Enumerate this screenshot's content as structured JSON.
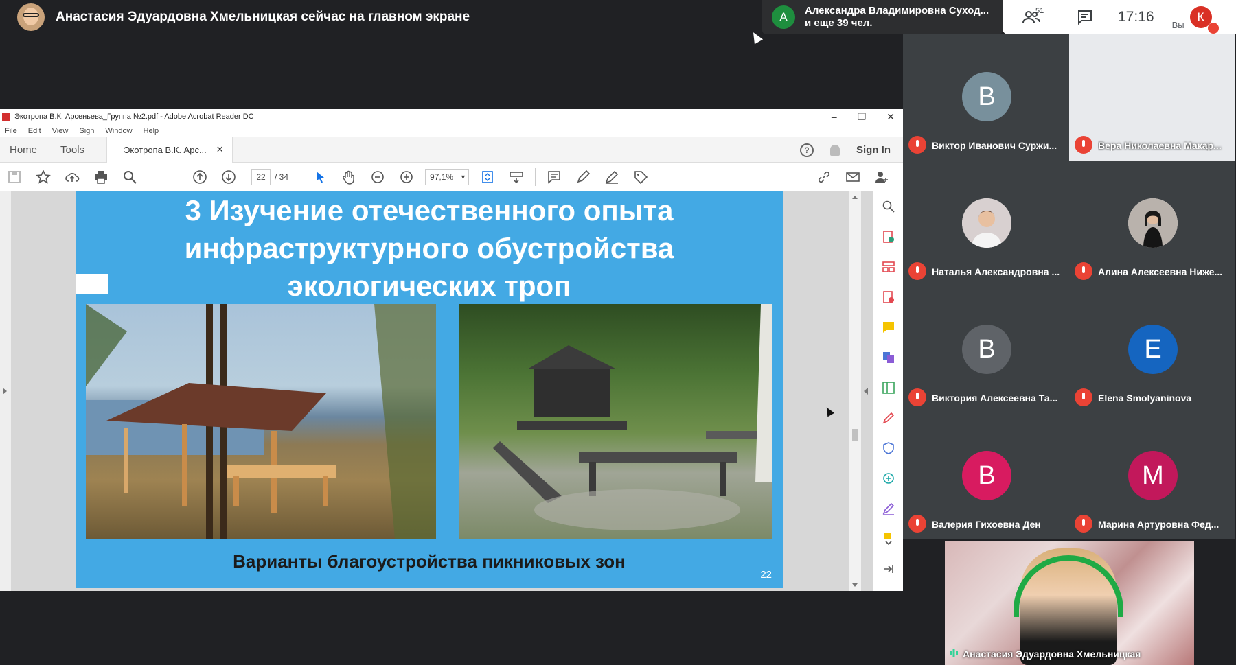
{
  "presenter": {
    "title": "Анастасия Эдуардовна Хмельницкая сейчас на главном экране"
  },
  "joiners": {
    "initial": "А",
    "line1": "Александра Владимировна Суход...",
    "line2": "и еще 39 чел."
  },
  "controls": {
    "people_count": "51",
    "time": "17:16",
    "you_label": "Вы",
    "self_initial": "К"
  },
  "acrobat": {
    "window_title": "Экотропа В.К. Арсеньева_Группа №2.pdf - Adobe Acrobat Reader DC",
    "menu": [
      "File",
      "Edit",
      "View",
      "Sign",
      "Window",
      "Help"
    ],
    "tabs": {
      "home": "Home",
      "tools": "Tools",
      "doc": "Экотропа В.К. Арс...",
      "sign_in": "Sign In"
    },
    "page_current": "22",
    "page_total": "/ 34",
    "zoom": "97,1%"
  },
  "slide": {
    "title_lines": [
      "3 Изучение отечественного опыта",
      "инфраструктурного обустройства",
      "экологических троп"
    ],
    "caption": "Варианты благоустройства пикниковых зон",
    "page_number": "22"
  },
  "participants": [
    {
      "name": "Виктор Иванович Суржи...",
      "initial": "В",
      "color": "#78909c"
    },
    {
      "name": "Вера Николаевна Макар...",
      "initial": "",
      "color": "#ffffff"
    },
    {
      "name": "Наталья Александровна ...",
      "initial": "",
      "color": "#e0e0e0"
    },
    {
      "name": "Алина Алексеевна Ниже...",
      "initial": "",
      "color": "#e0e0e0"
    },
    {
      "name": "Виктория Алексеевна Та...",
      "initial": "В",
      "color": "#5f6368"
    },
    {
      "name": "Elena Smolyaninova",
      "initial": "E",
      "color": "#1565c0"
    },
    {
      "name": "Валерия Гихоевна Ден",
      "initial": "В",
      "color": "#d81b60"
    },
    {
      "name": "Марина Артуровна Фед...",
      "initial": "М",
      "color": "#c2185b"
    }
  ],
  "self_view": {
    "name": "Анастасия Эдуардовна Хмельницкая"
  },
  "colors": {
    "meet_dark": "#202124",
    "tile": "#3c4043",
    "mute_red": "#ea4335",
    "slide_blue": "#43a9e4"
  },
  "icons": [
    "people-icon",
    "chat-icon",
    "mic-off-icon",
    "search-icon",
    "print-icon",
    "hand-icon"
  ]
}
